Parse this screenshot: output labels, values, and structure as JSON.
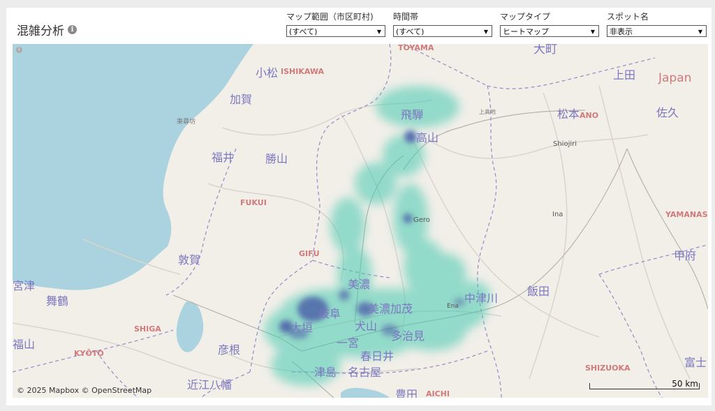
{
  "header": {
    "title": "混雑分析",
    "info_icon": "info-icon"
  },
  "filters": [
    {
      "label": "マップ範囲（市区町村)",
      "value": "(すべて)"
    },
    {
      "label": "時間帯",
      "value": "(すべて)"
    },
    {
      "label": "マップタイプ",
      "value": "ヒートマップ"
    },
    {
      "label": "スポット名",
      "value": "非表示"
    }
  ],
  "map": {
    "attribution": "© 2025 Mapbox  © OpenStreetMap",
    "scale_label": "50 km",
    "heat_color": "#45c9b0",
    "hotspot_color": "#4a5ca8",
    "place_labels": {
      "toyama_en": "TOYAMA",
      "omachi": "大町",
      "komatsu": "小松",
      "ishikawa_en": "ISHIKAWA",
      "ueda": "上田",
      "japan": "Japan",
      "kaga": "加賀",
      "hida": "飛騨",
      "matsumoto": "松本",
      "nano": "ANO",
      "saku": "佐久",
      "tojinbo": "東尋坊",
      "takayama": "高山",
      "kamikochi": "上高地",
      "shiojiri": "Shiojiri",
      "fukui": "福井",
      "katsuyama": "勝山",
      "fukui_en": "FUKUI",
      "gero": "Gero",
      "ina": "Ina",
      "yamanashi_en": "YAMANAS",
      "gifu_en": "GIFU",
      "tsuruga": "敦賀",
      "kofu": "甲府",
      "mino": "美濃",
      "miyazu": "宮津",
      "maizuru": "舞鶴",
      "iida": "飯田",
      "nakatsugawa": "中津川",
      "ena": "Ena",
      "gifu": "岐阜",
      "minokamo": "美濃加茂",
      "ogaki": "大垣",
      "inuyama": "犬山",
      "shiga_en": "SHIGA",
      "tajimi": "多治見",
      "kyoto_en": "KYŌTO",
      "ichinomiya": "一宮",
      "hikone": "彦根",
      "kasugai": "春日井",
      "fukuchiyama": "福山",
      "tsushima": "津島",
      "nagoya": "名古屋",
      "shizuoka_en": "SHIZUOKA",
      "omihachiman": "近江八幡",
      "toyota": "豊田",
      "aichi_en": "AICHI",
      "fuji": "富士"
    }
  }
}
